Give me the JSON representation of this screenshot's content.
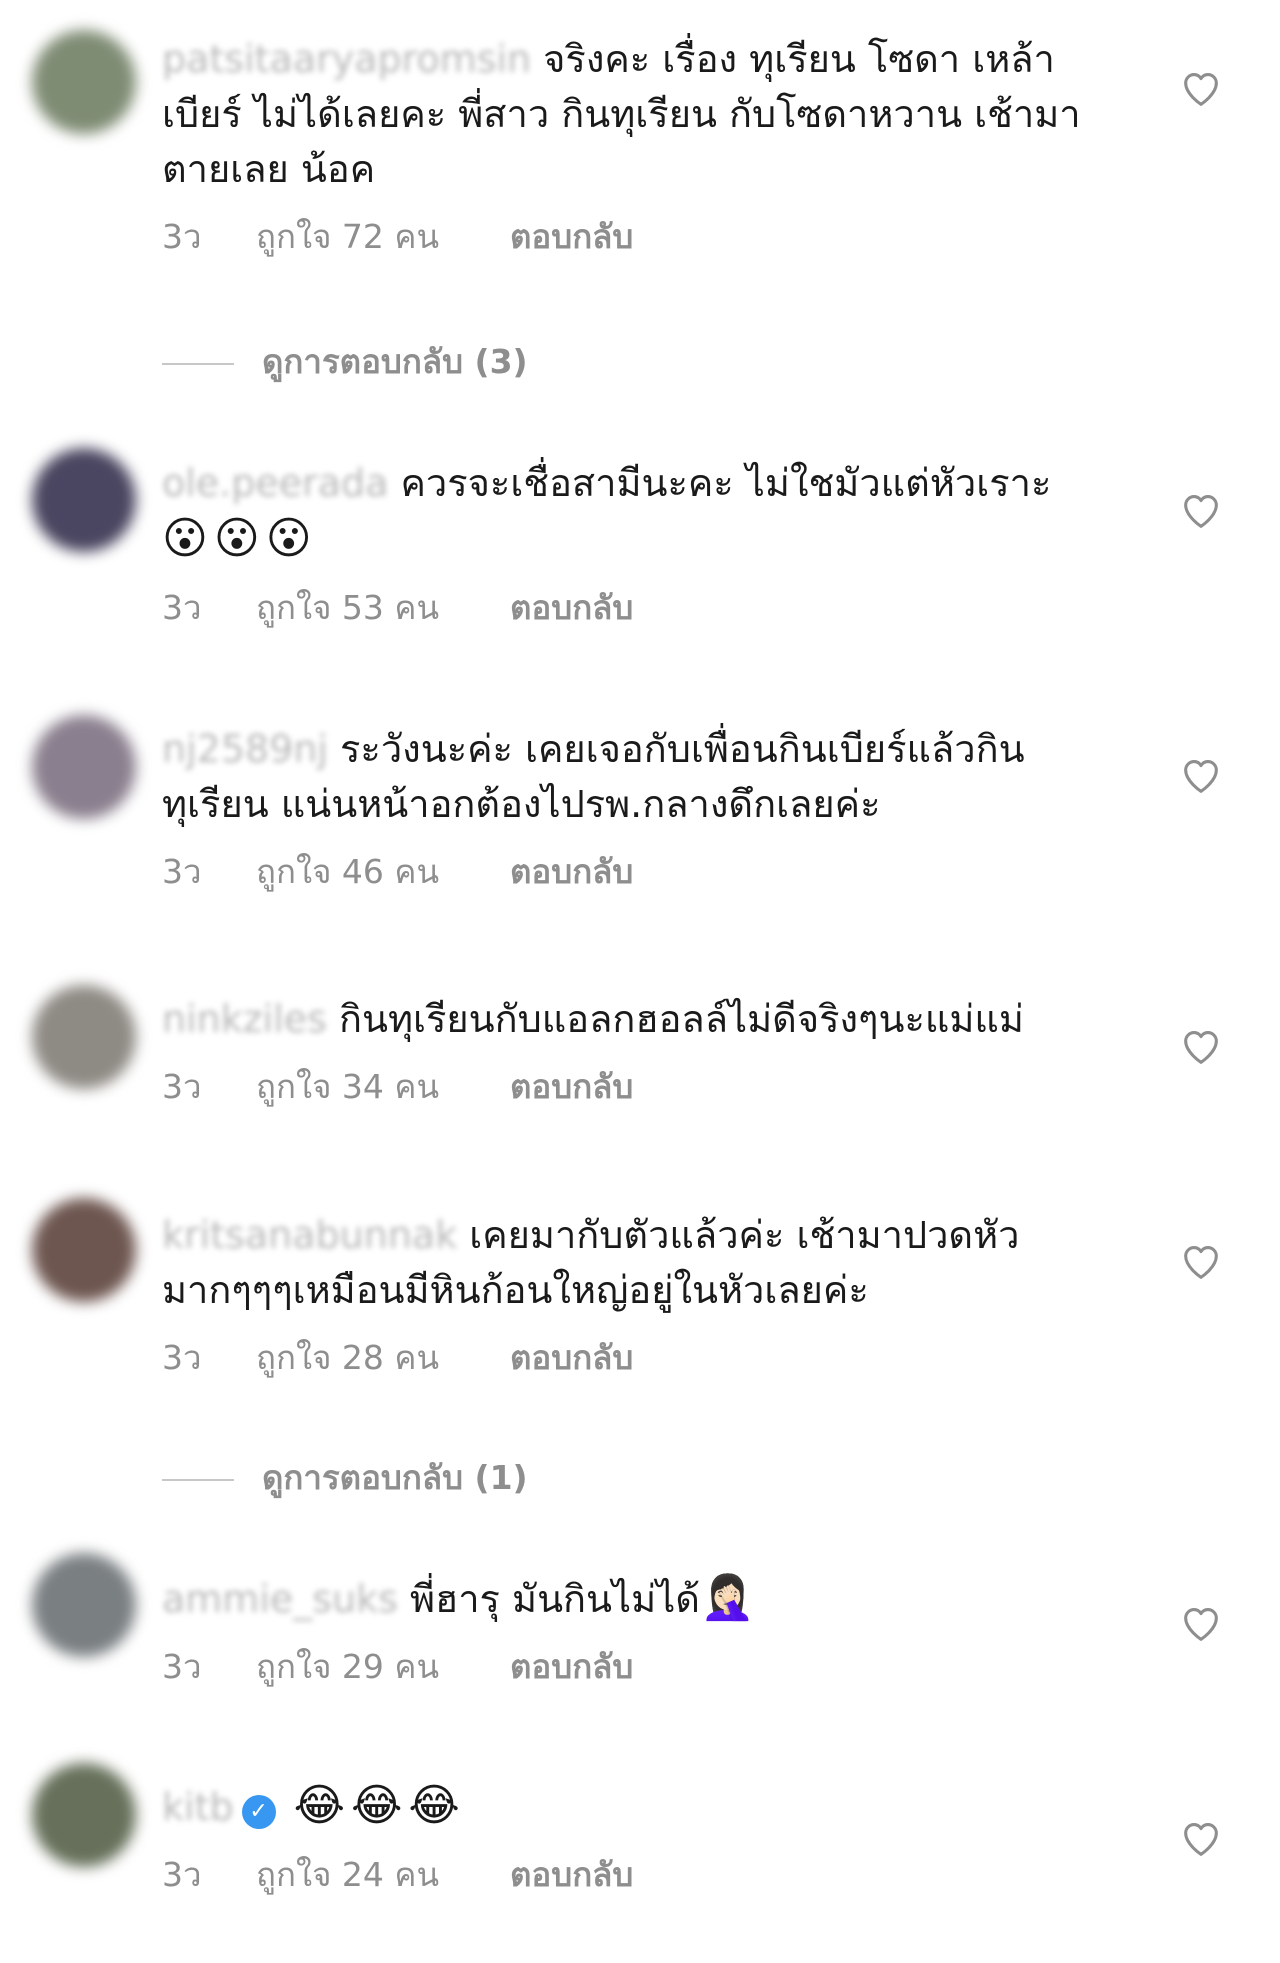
{
  "comments": [
    {
      "username": "patsitaaryapromsin",
      "text": "จริงคะ เรื่อง ทุเรียน โซดา เหล้า เบียร์ ไม่ได้เลยคะ พี่สาว กินทุเรียน กับโซดาหวาน เช้ามาตายเลย น้อค",
      "time": "3ว",
      "likes": "ถูกใจ 72 คน",
      "reply": "ตอบกลับ"
    },
    {
      "username": "ole.peerada",
      "text": "ควรจะเชื่อสามีนะคะ ไม่ใชมัวแต่หัวเราะ",
      "emoji": "😮😮😮",
      "time": "3ว",
      "likes": "ถูกใจ 53 คน",
      "reply": "ตอบกลับ"
    },
    {
      "username": "nj2589nj",
      "text": "ระวังนะค่ะ เคยเจอกับเพื่อนกินเบียร์แล้วกินทุเรียน แน่นหน้าอกต้องไปรพ.กลางดึกเลยค่ะ",
      "time": "3ว",
      "likes": "ถูกใจ 46 คน",
      "reply": "ตอบกลับ"
    },
    {
      "username": "ninkziles",
      "text": "กินทุเรียนกับแอลกฮอลล์ไม่ดีจริงๆนะแม่แม่",
      "time": "3ว",
      "likes": "ถูกใจ 34 คน",
      "reply": "ตอบกลับ"
    },
    {
      "username": "kritsanabunnak",
      "text": "เคยมากับตัวแล้วค่ะ เช้ามาปวดหัวมากๆๆๆเหมือนมีหินก้อนใหญ่อยู่ในหัวเลยค่ะ",
      "time": "3ว",
      "likes": "ถูกใจ 28 คน",
      "reply": "ตอบกลับ"
    },
    {
      "username": "ammie_suks",
      "text": "พี่ฮารุ มันกินไม่ได้",
      "emoji": "🤦🏻‍♀️",
      "time": "3ว",
      "likes": "ถูกใจ 29 คน",
      "reply": "ตอบกลับ"
    },
    {
      "username": "kitb",
      "verified": "✓",
      "emoji": "😂😂😂",
      "time": "3ว",
      "likes": "ถูกใจ 24 คน",
      "reply": "ตอบกลับ"
    }
  ],
  "view_replies": [
    "ดูการตอบกลับ (3)",
    "ดูการตอบกลับ (1)"
  ],
  "avatar_colors": [
    "#7f8c74",
    "#4a4560",
    "#8a7f8e",
    "#8e8a84",
    "#6e5650",
    "#7a7f82",
    "#66705a"
  ],
  "icons": {
    "like": "heart-outline-icon",
    "verified": "verified-badge-icon"
  }
}
